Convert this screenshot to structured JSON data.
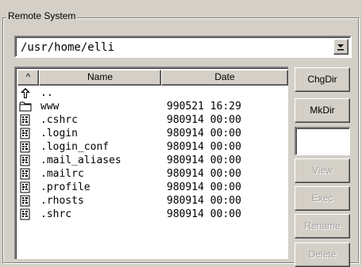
{
  "group": {
    "title": "Remote System"
  },
  "path": {
    "value": "/usr/home/elli"
  },
  "list": {
    "headers": {
      "sort": "^",
      "name": "Name",
      "date": "Date"
    },
    "rows": [
      {
        "icon": "parent-dir-icon",
        "name": "..",
        "date": ""
      },
      {
        "icon": "folder-icon",
        "name": "www",
        "date": "990521 16:29"
      },
      {
        "icon": "file-icon",
        "name": ".cshrc",
        "date": "980914 00:00"
      },
      {
        "icon": "file-icon",
        "name": ".login",
        "date": "980914 00:00"
      },
      {
        "icon": "file-icon",
        "name": ".login_conf",
        "date": "980914 00:00"
      },
      {
        "icon": "file-icon",
        "name": ".mail_aliases",
        "date": "980914 00:00"
      },
      {
        "icon": "file-icon",
        "name": ".mailrc",
        "date": "980914 00:00"
      },
      {
        "icon": "file-icon",
        "name": ".profile",
        "date": "980914 00:00"
      },
      {
        "icon": "file-icon",
        "name": ".rhosts",
        "date": "980914 00:00"
      },
      {
        "icon": "file-icon",
        "name": ".shrc",
        "date": "980914 00:00"
      }
    ]
  },
  "buttons": {
    "chgdir": "ChgDir",
    "mkdir": "MkDir",
    "view": "View",
    "exec": "Exec",
    "rename": "Rename",
    "delete": "Delete"
  },
  "mkdir_input": {
    "value": ""
  }
}
